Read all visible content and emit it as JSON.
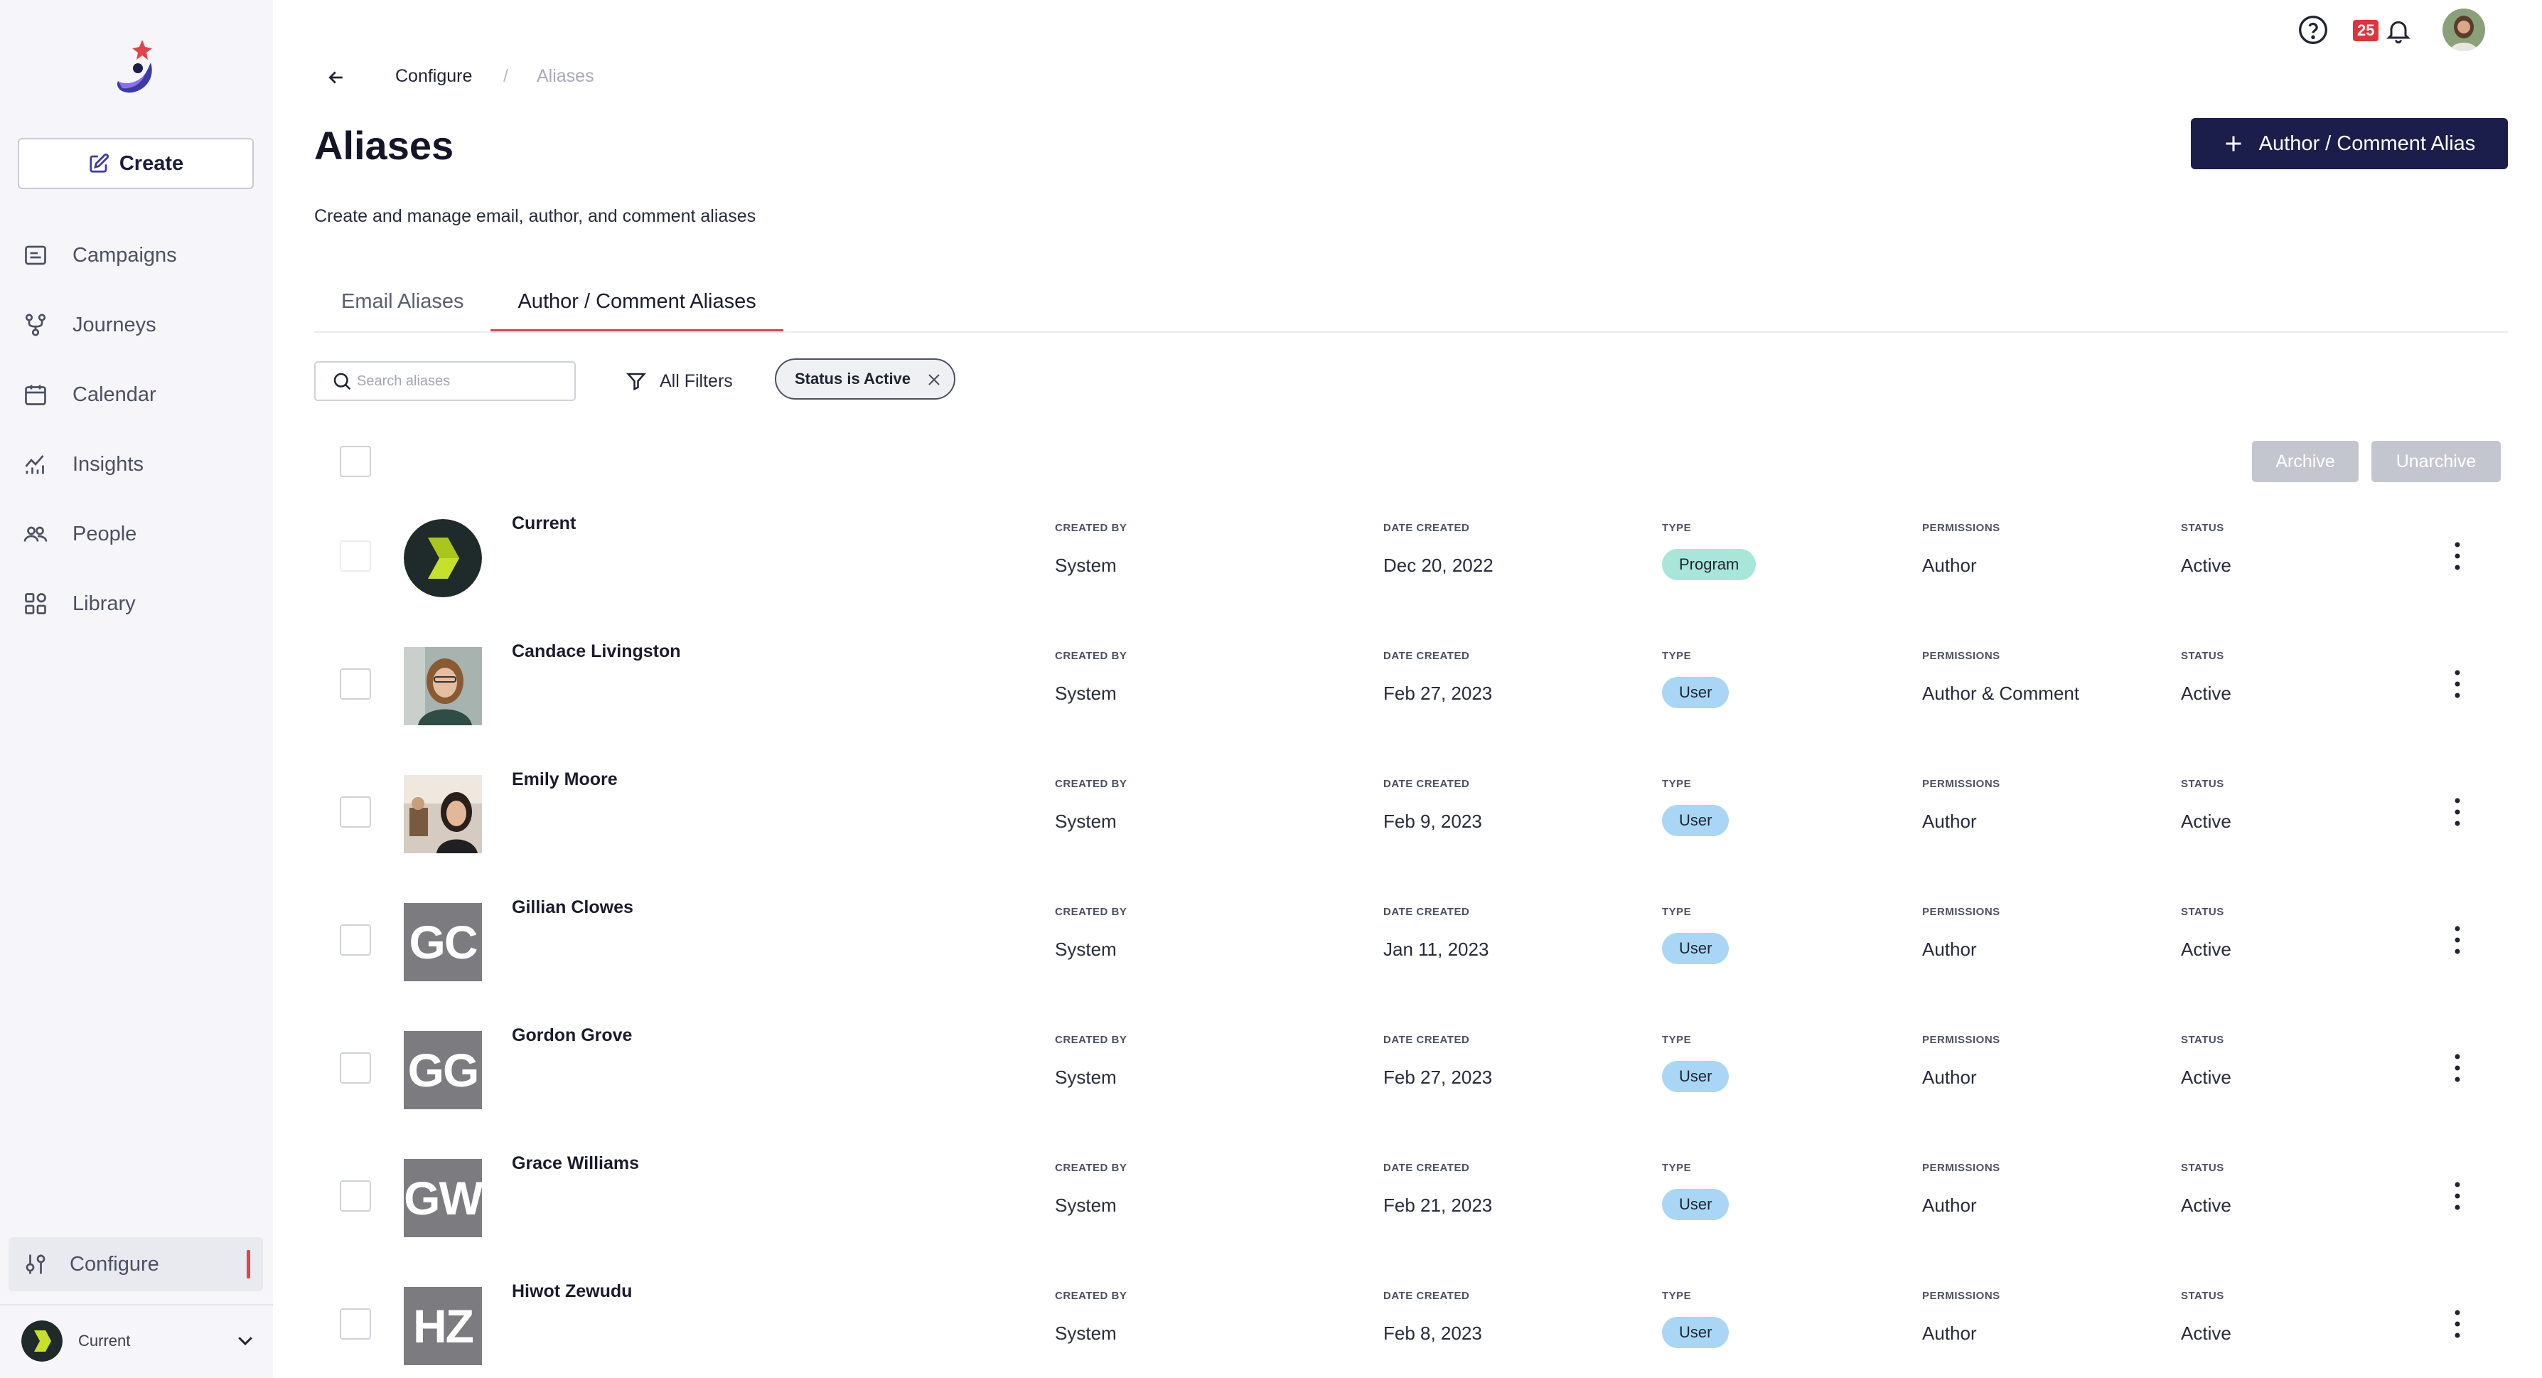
{
  "sidebar": {
    "create_label": "Create",
    "nav": [
      {
        "label": "Campaigns",
        "icon": "campaigns-icon"
      },
      {
        "label": "Journeys",
        "icon": "journeys-icon"
      },
      {
        "label": "Calendar",
        "icon": "calendar-icon"
      },
      {
        "label": "Insights",
        "icon": "insights-icon"
      },
      {
        "label": "People",
        "icon": "people-icon"
      },
      {
        "label": "Library",
        "icon": "library-icon"
      }
    ],
    "configure_label": "Configure",
    "account_name": "Current"
  },
  "topbar": {
    "notification_count": "25"
  },
  "breadcrumb": {
    "parent": "Configure",
    "separator": "/",
    "current": "Aliases"
  },
  "page": {
    "title": "Aliases",
    "subtitle": "Create and manage email, author, and comment aliases",
    "primary_button": "Author / Comment Alias"
  },
  "tabs": [
    {
      "label": "Email Aliases",
      "active": false
    },
    {
      "label": "Author / Comment Aliases",
      "active": true
    }
  ],
  "filters": {
    "search_placeholder": "Search aliases",
    "all_filters_label": "All Filters",
    "chip_label": "Status is Active"
  },
  "bulk": {
    "archive_label": "Archive",
    "unarchive_label": "Unarchive"
  },
  "columns": {
    "created_by": "CREATED BY",
    "date_created": "DATE CREATED",
    "type": "TYPE",
    "permissions": "PERMISSIONS",
    "status": "STATUS"
  },
  "colors": {
    "accent": "#e2434b",
    "primary": "#1b1d4a",
    "program_pill": "#a8e6da",
    "user_pill": "#a9d6f5",
    "initials_bg": "#7c7c80"
  },
  "rows": [
    {
      "name": "Current",
      "avatar": "current-logo",
      "created_by": "System",
      "date": "Dec 20, 2022",
      "type": "Program",
      "permissions": "Author",
      "status": "Active"
    },
    {
      "name": "Candace Livingston",
      "avatar": "photo",
      "created_by": "System",
      "date": "Feb 27, 2023",
      "type": "User",
      "permissions": "Author & Comment",
      "status": "Active"
    },
    {
      "name": "Emily Moore",
      "avatar": "photo",
      "created_by": "System",
      "date": "Feb 9, 2023",
      "type": "User",
      "permissions": "Author",
      "status": "Active"
    },
    {
      "name": "Gillian Clowes",
      "avatar": "initials",
      "initials": "GC",
      "created_by": "System",
      "date": "Jan 11, 2023",
      "type": "User",
      "permissions": "Author",
      "status": "Active"
    },
    {
      "name": "Gordon Grove",
      "avatar": "initials",
      "initials": "GG",
      "created_by": "System",
      "date": "Feb 27, 2023",
      "type": "User",
      "permissions": "Author",
      "status": "Active"
    },
    {
      "name": "Grace Williams",
      "avatar": "initials",
      "initials": "GW",
      "created_by": "System",
      "date": "Feb 21, 2023",
      "type": "User",
      "permissions": "Author",
      "status": "Active"
    },
    {
      "name": "Hiwot Zewudu",
      "avatar": "initials",
      "initials": "HZ",
      "created_by": "System",
      "date": "Feb 8, 2023",
      "type": "User",
      "permissions": "Author",
      "status": "Active"
    }
  ]
}
